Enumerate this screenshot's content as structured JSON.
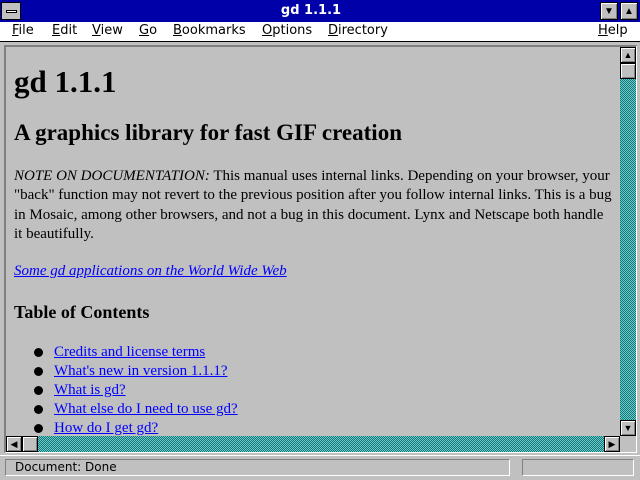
{
  "window": {
    "title": "gd 1.1.1"
  },
  "menu": [
    "File",
    "Edit",
    "View",
    "Go",
    "Bookmarks",
    "Options",
    "Directory",
    "Help"
  ],
  "page": {
    "heading": "gd 1.1.1",
    "subheading": "A graphics library for fast GIF creation",
    "note_label": "NOTE ON DOCUMENTATION:",
    "note_text": " This manual uses internal links. Depending on your browser, your \"back\" function may not revert to the previous position after you follow internal links. This is a bug in Mosaic, among other browsers, and not a bug in this document. Lynx and Netscape both handle it beautifully.",
    "applications_link": "Some gd applications on the World Wide Web",
    "toc_heading": "Table of Contents",
    "toc": [
      "Credits and license terms",
      "What's new in version 1.1.1?",
      "What is gd?",
      "What else do I need to use gd?",
      "How do I get gd?"
    ]
  },
  "status": {
    "text": "Document: Done"
  },
  "icons": {
    "system_menu": "system-menu-icon",
    "minimize": "minimize-icon",
    "maximize": "maximize-icon"
  }
}
